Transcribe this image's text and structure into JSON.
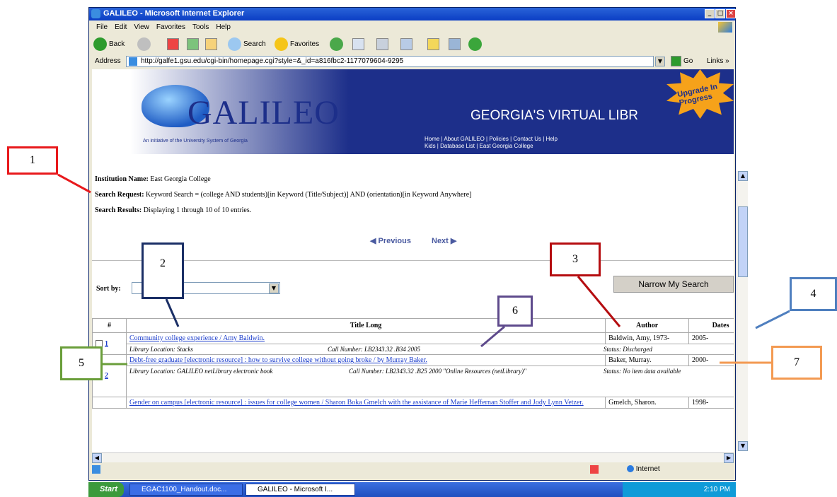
{
  "window": {
    "title": "GALILEO - Microsoft Internet Explorer",
    "controls": [
      "_",
      "□",
      "×"
    ]
  },
  "menu": [
    "File",
    "Edit",
    "View",
    "Favorites",
    "Tools",
    "Help"
  ],
  "toolbar": {
    "back": "Back",
    "search": "Search",
    "favorites": "Favorites"
  },
  "address": {
    "label": "Address",
    "url": "http://galfe1.gsu.edu/cgi-bin/homepage.cgi?style=&_id=a816fbc2-1177079604-9295",
    "go": "Go",
    "links": "Links »"
  },
  "banner": {
    "logo": "GALILEO",
    "tagline": "An initiative of the University System of Georgia",
    "headline": "GEORGIA'S VIRTUAL LIBR",
    "nav1": "Home | About GALILEO | Policies | Contact Us | Help",
    "nav2": "Kids | Database List | East Georgia College",
    "badge": "Upgrade In Progress"
  },
  "info": {
    "institution_label": "Institution Name:",
    "institution": "East Georgia College",
    "request_label": "Search Request:",
    "request": "Keyword Search = (college AND students)[in Keyword (Title/Subject)] AND (orientation)[in Keyword Anywhere]",
    "results_label": "Search Results:",
    "results": "Displaying 1 through 10 of 10 entries."
  },
  "pager": {
    "previous": "Previous",
    "next": "Next"
  },
  "sort": {
    "label": "Sort by:",
    "value": ""
  },
  "narrow_button": "Narrow My Search",
  "table": {
    "headers": [
      "#",
      "Title Long",
      "Author",
      "Dates"
    ],
    "rows": [
      {
        "num": "1",
        "title": "Community college experience / Amy Baldwin.",
        "author": "Baldwin, Amy, 1973-",
        "date": "2005-",
        "location": "Library Location: Stacks",
        "call": "Call Number: LB2343.32 .B34 2005",
        "status": "Status: Discharged"
      },
      {
        "num": "2",
        "title": "Debt-free graduate [electronic resource] : how to survive college without going broke / by Murray Baker.",
        "author": "Baker, Murray.",
        "date": "2000-",
        "location": "Library Location: GALILEO netLibrary electronic book",
        "call": "Call Number: LB2343.32 .B25 2000 \"Online Resources (netLibrary)\"",
        "status": "Status: No item data available"
      },
      {
        "num": "",
        "title": "Gender on campus [electronic resource] : issues for college women / Sharon Boka Gmelch with the assistance of Marie Heffernan Stoffer and Jody Lynn Vetzer.",
        "author": "Gmelch, Sharon.",
        "date": "1998-",
        "location": "",
        "call": "",
        "status": ""
      }
    ]
  },
  "statusbar": {
    "zone": "Internet"
  },
  "taskbar": {
    "start": "Start",
    "task1": "EGAC1100_Handout.doc...",
    "task2": "GALILEO - Microsoft I...",
    "clock": "2:10 PM"
  },
  "callouts": [
    "1",
    "2",
    "3",
    "4",
    "5",
    "6",
    "7"
  ],
  "colors": {
    "c1": "#e8191c",
    "c2": "#1b2f66",
    "c3": "#b50d10",
    "c4": "#4f7fbf",
    "c5": "#6a9e3a",
    "c6": "#5e4a8c",
    "c7": "#f39a52"
  }
}
